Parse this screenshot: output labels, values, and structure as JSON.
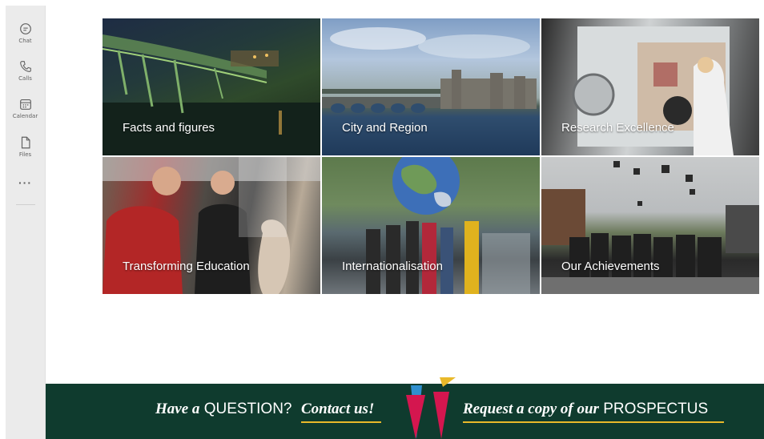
{
  "rail": {
    "items": [
      {
        "label": "Chat",
        "icon": "chat-icon"
      },
      {
        "label": "Calls",
        "icon": "phone-icon"
      },
      {
        "label": "Calendar",
        "icon": "calendar-icon"
      },
      {
        "label": "Files",
        "icon": "file-icon"
      }
    ],
    "more": "···"
  },
  "tiles": [
    {
      "caption": "Facts and figures"
    },
    {
      "caption": "City and Region"
    },
    {
      "caption": "Research Excellence"
    },
    {
      "caption": "Transforming Education"
    },
    {
      "caption": "Internationalisation"
    },
    {
      "caption": "Our Achievements"
    }
  ],
  "banner": {
    "have_a": "Have a",
    "question": "QUESTION?",
    "contact": "Contact us!",
    "request": "Request a copy of our",
    "prospectus": "PROSPECTUS",
    "background": "#0f3b2e",
    "underline": "#e9b92a"
  }
}
